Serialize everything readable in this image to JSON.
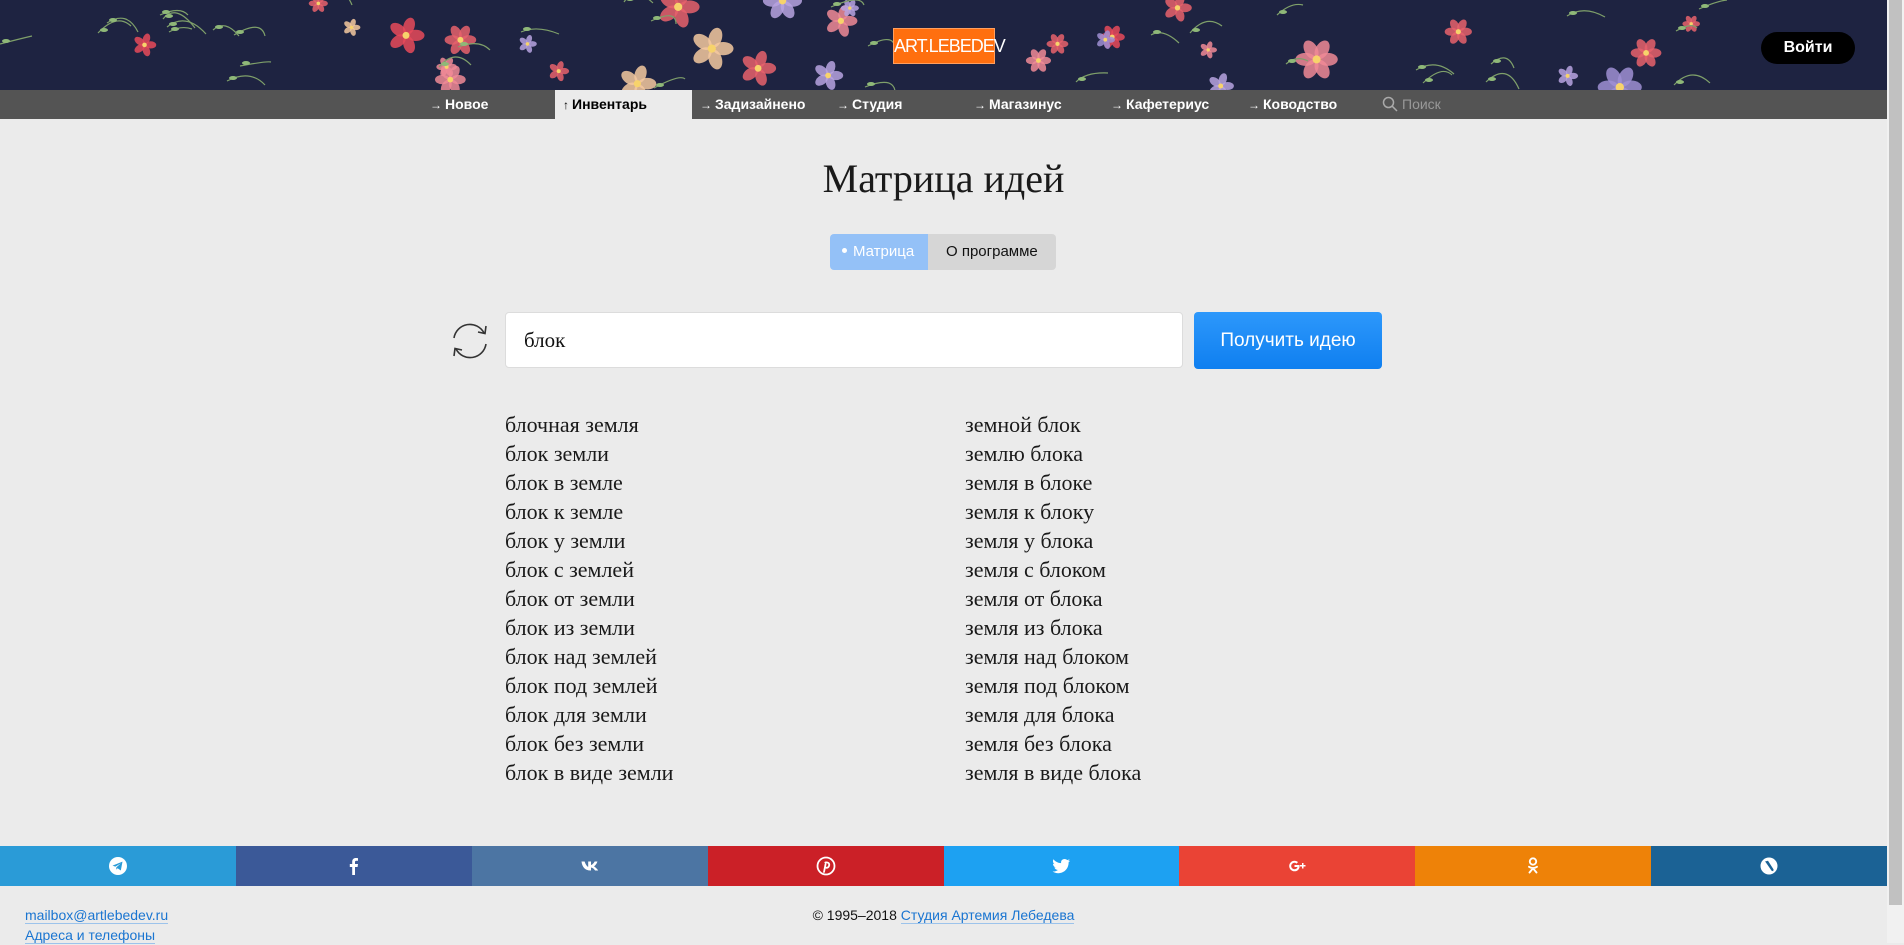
{
  "header": {
    "logo_text": "ART.LEBEDEV",
    "login_label": "Войти"
  },
  "nav": {
    "items": [
      {
        "label": "Новое",
        "active": false
      },
      {
        "label": "Инвентарь",
        "active": true
      },
      {
        "label": "Задизайнено",
        "active": false
      },
      {
        "label": "Студия",
        "active": false
      },
      {
        "label": "Магазинус",
        "active": false
      },
      {
        "label": "Кафетериус",
        "active": false
      },
      {
        "label": "Ководство",
        "active": false
      }
    ],
    "search_placeholder": "Поиск"
  },
  "page": {
    "title": "Матрица идей",
    "tabs": [
      {
        "label": "Матрица",
        "active": true
      },
      {
        "label": "О программе",
        "active": false
      }
    ],
    "input_value": "блок",
    "submit_label": "Получить идею"
  },
  "results": {
    "left": [
      "блочная земля",
      "блок земли",
      "блок в земле",
      "блок к земле",
      "блок у земли",
      "блок с землей",
      "блок от земли",
      "блок из земли",
      "блок над землей",
      "блок под землей",
      "блок для земли",
      "блок без земли",
      "блок в виде земли"
    ],
    "right": [
      "земной блок",
      "землю блока",
      "земля в блоке",
      "земля к блоку",
      "земля у блока",
      "земля с блоком",
      "земля от блока",
      "земля из блока",
      "земля над блоком",
      "земля под блоком",
      "земля для блока",
      "земля без блока",
      "земля в виде блока"
    ]
  },
  "social": [
    {
      "name": "telegram-icon",
      "color": "#2a9bd7"
    },
    {
      "name": "facebook-icon",
      "color": "#3b5998"
    },
    {
      "name": "vk-icon",
      "color": "#4c75a3"
    },
    {
      "name": "pinterest-icon",
      "color": "#cb2027"
    },
    {
      "name": "twitter-icon",
      "color": "#1da1f2"
    },
    {
      "name": "googleplus-icon",
      "color": "#ea4335"
    },
    {
      "name": "odnoklassniki-icon",
      "color": "#ee8208"
    },
    {
      "name": "livejournal-icon",
      "color": "#1b6295"
    }
  ],
  "footer": {
    "email": "mailbox@artlebedev.ru",
    "addresses": "Адреса и телефоны",
    "copyright_prefix": "© 1995–2018",
    "studio_link": "Студия Артемия Лебедева"
  }
}
